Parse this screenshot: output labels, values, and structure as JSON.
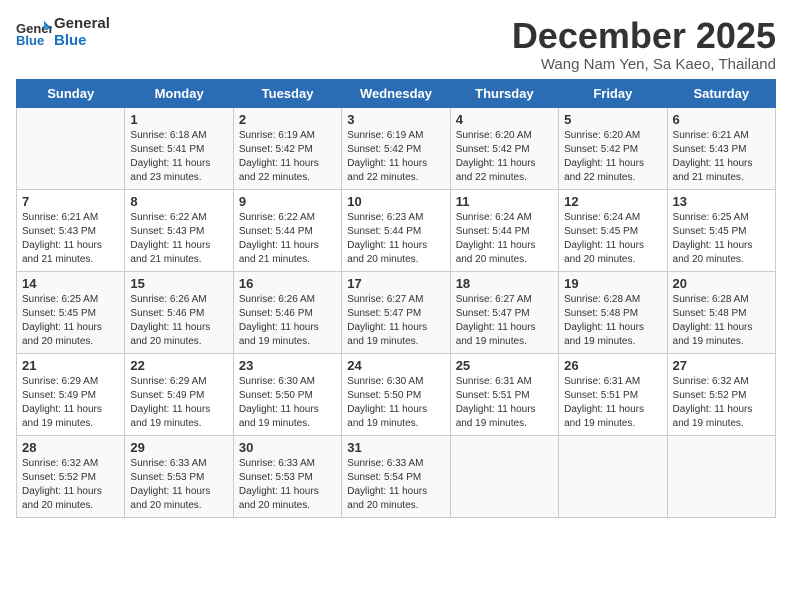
{
  "logo": {
    "general": "General",
    "blue": "Blue"
  },
  "header": {
    "month": "December 2025",
    "location": "Wang Nam Yen, Sa Kaeo, Thailand"
  },
  "days": [
    "Sunday",
    "Monday",
    "Tuesday",
    "Wednesday",
    "Thursday",
    "Friday",
    "Saturday"
  ],
  "weeks": [
    [
      {
        "day": "",
        "content": ""
      },
      {
        "day": "1",
        "content": "Sunrise: 6:18 AM\nSunset: 5:41 PM\nDaylight: 11 hours\nand 23 minutes."
      },
      {
        "day": "2",
        "content": "Sunrise: 6:19 AM\nSunset: 5:42 PM\nDaylight: 11 hours\nand 22 minutes."
      },
      {
        "day": "3",
        "content": "Sunrise: 6:19 AM\nSunset: 5:42 PM\nDaylight: 11 hours\nand 22 minutes."
      },
      {
        "day": "4",
        "content": "Sunrise: 6:20 AM\nSunset: 5:42 PM\nDaylight: 11 hours\nand 22 minutes."
      },
      {
        "day": "5",
        "content": "Sunrise: 6:20 AM\nSunset: 5:42 PM\nDaylight: 11 hours\nand 22 minutes."
      },
      {
        "day": "6",
        "content": "Sunrise: 6:21 AM\nSunset: 5:43 PM\nDaylight: 11 hours\nand 21 minutes."
      }
    ],
    [
      {
        "day": "7",
        "content": "Sunrise: 6:21 AM\nSunset: 5:43 PM\nDaylight: 11 hours\nand 21 minutes."
      },
      {
        "day": "8",
        "content": "Sunrise: 6:22 AM\nSunset: 5:43 PM\nDaylight: 11 hours\nand 21 minutes."
      },
      {
        "day": "9",
        "content": "Sunrise: 6:22 AM\nSunset: 5:44 PM\nDaylight: 11 hours\nand 21 minutes."
      },
      {
        "day": "10",
        "content": "Sunrise: 6:23 AM\nSunset: 5:44 PM\nDaylight: 11 hours\nand 20 minutes."
      },
      {
        "day": "11",
        "content": "Sunrise: 6:24 AM\nSunset: 5:44 PM\nDaylight: 11 hours\nand 20 minutes."
      },
      {
        "day": "12",
        "content": "Sunrise: 6:24 AM\nSunset: 5:45 PM\nDaylight: 11 hours\nand 20 minutes."
      },
      {
        "day": "13",
        "content": "Sunrise: 6:25 AM\nSunset: 5:45 PM\nDaylight: 11 hours\nand 20 minutes."
      }
    ],
    [
      {
        "day": "14",
        "content": "Sunrise: 6:25 AM\nSunset: 5:45 PM\nDaylight: 11 hours\nand 20 minutes."
      },
      {
        "day": "15",
        "content": "Sunrise: 6:26 AM\nSunset: 5:46 PM\nDaylight: 11 hours\nand 20 minutes."
      },
      {
        "day": "16",
        "content": "Sunrise: 6:26 AM\nSunset: 5:46 PM\nDaylight: 11 hours\nand 19 minutes."
      },
      {
        "day": "17",
        "content": "Sunrise: 6:27 AM\nSunset: 5:47 PM\nDaylight: 11 hours\nand 19 minutes."
      },
      {
        "day": "18",
        "content": "Sunrise: 6:27 AM\nSunset: 5:47 PM\nDaylight: 11 hours\nand 19 minutes."
      },
      {
        "day": "19",
        "content": "Sunrise: 6:28 AM\nSunset: 5:48 PM\nDaylight: 11 hours\nand 19 minutes."
      },
      {
        "day": "20",
        "content": "Sunrise: 6:28 AM\nSunset: 5:48 PM\nDaylight: 11 hours\nand 19 minutes."
      }
    ],
    [
      {
        "day": "21",
        "content": "Sunrise: 6:29 AM\nSunset: 5:49 PM\nDaylight: 11 hours\nand 19 minutes."
      },
      {
        "day": "22",
        "content": "Sunrise: 6:29 AM\nSunset: 5:49 PM\nDaylight: 11 hours\nand 19 minutes."
      },
      {
        "day": "23",
        "content": "Sunrise: 6:30 AM\nSunset: 5:50 PM\nDaylight: 11 hours\nand 19 minutes."
      },
      {
        "day": "24",
        "content": "Sunrise: 6:30 AM\nSunset: 5:50 PM\nDaylight: 11 hours\nand 19 minutes."
      },
      {
        "day": "25",
        "content": "Sunrise: 6:31 AM\nSunset: 5:51 PM\nDaylight: 11 hours\nand 19 minutes."
      },
      {
        "day": "26",
        "content": "Sunrise: 6:31 AM\nSunset: 5:51 PM\nDaylight: 11 hours\nand 19 minutes."
      },
      {
        "day": "27",
        "content": "Sunrise: 6:32 AM\nSunset: 5:52 PM\nDaylight: 11 hours\nand 19 minutes."
      }
    ],
    [
      {
        "day": "28",
        "content": "Sunrise: 6:32 AM\nSunset: 5:52 PM\nDaylight: 11 hours\nand 20 minutes."
      },
      {
        "day": "29",
        "content": "Sunrise: 6:33 AM\nSunset: 5:53 PM\nDaylight: 11 hours\nand 20 minutes."
      },
      {
        "day": "30",
        "content": "Sunrise: 6:33 AM\nSunset: 5:53 PM\nDaylight: 11 hours\nand 20 minutes."
      },
      {
        "day": "31",
        "content": "Sunrise: 6:33 AM\nSunset: 5:54 PM\nDaylight: 11 hours\nand 20 minutes."
      },
      {
        "day": "",
        "content": ""
      },
      {
        "day": "",
        "content": ""
      },
      {
        "day": "",
        "content": ""
      }
    ]
  ]
}
